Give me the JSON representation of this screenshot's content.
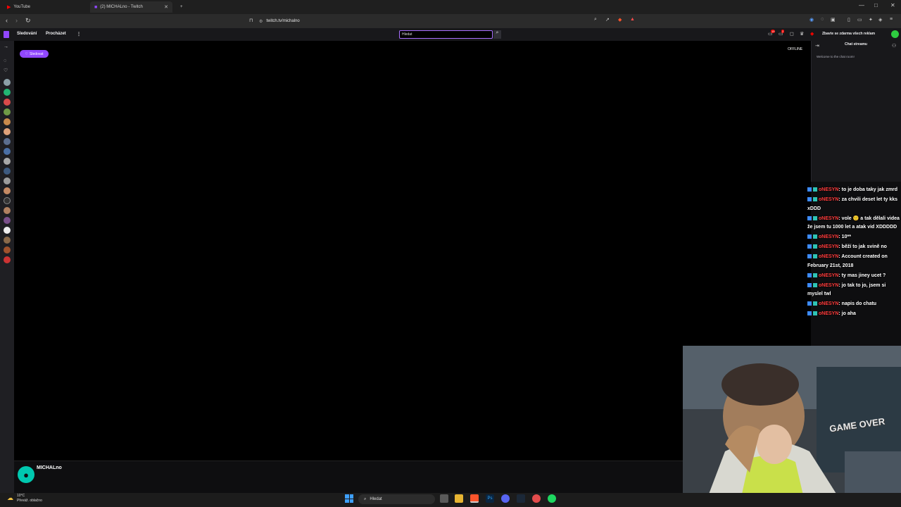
{
  "browser": {
    "tabs": [
      {
        "title": "YouTube"
      },
      {
        "title": "(2) MICHALno - Twitch"
      }
    ],
    "new_tab": "+",
    "url": "twitch.tv/michalno"
  },
  "topnav": {
    "following": "Sledování",
    "browse": "Procházet",
    "more": "⋮",
    "search_placeholder": "Hledat",
    "notifications_badge": "19",
    "whispers_badge": "2",
    "promo": "Zbavte se zdarma všech reklam"
  },
  "player": {
    "follow_label": "Sledovat",
    "status": "OFFLINE"
  },
  "channel": {
    "name": "MICHALno"
  },
  "chat": {
    "header": "Chat streamu",
    "welcome": "Welcome to the chat room!",
    "messages": [
      {
        "user": "oNESYN",
        "text": ": to je doba taky jak zmrd"
      },
      {
        "user": "oNESYN",
        "text": ": za chvili deset let ty kks xDDD"
      },
      {
        "user": "oNESYN",
        "text": ": vole 🙂 a tak dělali videa že jsem tu 1000 let a atak vid XDDDDD"
      },
      {
        "user": "oNESYN",
        "text": ": 10**"
      },
      {
        "user": "oNESYN",
        "text": ": běží to jak svině no"
      },
      {
        "user": "oNESYN",
        "text": ": Account created on February 21st, 2018"
      },
      {
        "user": "oNESYN",
        "text": ": ty mas jiney ucet ?"
      },
      {
        "user": "oNESYN",
        "text": ": jo tak to jo, jsem si myslel twl"
      },
      {
        "user": "oNESYN",
        "text": ": napis do chatu"
      },
      {
        "user": "oNESYN",
        "text": ": jo aha"
      }
    ]
  },
  "webcam": {
    "sign": "GAME OVER"
  },
  "taskbar": {
    "temperature": "10°C",
    "weather": "Převáž. oblačno",
    "search": "Hledat"
  }
}
